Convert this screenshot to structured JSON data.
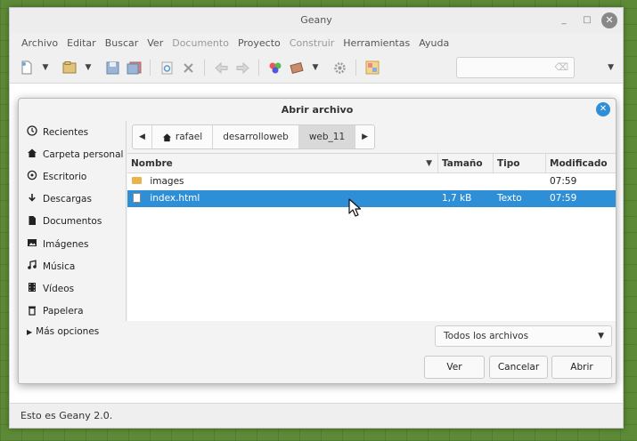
{
  "window": {
    "title": "Geany",
    "controls": {
      "minimize": "_",
      "maximize": "□",
      "close": "✕"
    }
  },
  "menubar": [
    {
      "label": "Archivo",
      "disabled": false
    },
    {
      "label": "Editar",
      "disabled": false
    },
    {
      "label": "Buscar",
      "disabled": false
    },
    {
      "label": "Ver",
      "disabled": false
    },
    {
      "label": "Documento",
      "disabled": true
    },
    {
      "label": "Proyecto",
      "disabled": false
    },
    {
      "label": "Construir",
      "disabled": true
    },
    {
      "label": "Herramientas",
      "disabled": false
    },
    {
      "label": "Ayuda",
      "disabled": false
    }
  ],
  "toolbar": {
    "icons": [
      "new-file-icon",
      "open-file-icon",
      "save-icon",
      "save-all-icon",
      "reload-icon",
      "close-file-icon",
      "back-icon",
      "forward-icon",
      "color-chooser-icon",
      "compile-icon",
      "build-icon",
      "preferences-icon",
      "jump-to-line-icon"
    ]
  },
  "statusbar": {
    "text": "Esto es Geany 2.0."
  },
  "dialog": {
    "title": "Abrir archivo",
    "places": [
      {
        "label": "Recientes",
        "icon": "clock-icon"
      },
      {
        "label": "Carpeta personal",
        "icon": "home-icon"
      },
      {
        "label": "Escritorio",
        "icon": "desktop-icon"
      },
      {
        "label": "Descargas",
        "icon": "download-icon"
      },
      {
        "label": "Documentos",
        "icon": "document-icon"
      },
      {
        "label": "Imágenes",
        "icon": "image-icon"
      },
      {
        "label": "Música",
        "icon": "music-icon"
      },
      {
        "label": "Vídeos",
        "icon": "video-icon"
      },
      {
        "label": "Papelera",
        "icon": "trash-icon"
      }
    ],
    "more_options": "Más opciones",
    "path": [
      "rafael",
      "desarrolloweb",
      "web_11"
    ],
    "columns": {
      "name": "Nombre",
      "size": "Tamaño",
      "type": "Tipo",
      "modified": "Modificado"
    },
    "files": [
      {
        "name": "images",
        "kind": "folder",
        "size": "",
        "type": "",
        "modified": "07:59",
        "selected": false
      },
      {
        "name": "index.html",
        "kind": "file",
        "size": "1,7 kB",
        "type": "Texto",
        "modified": "07:59",
        "selected": true
      }
    ],
    "filter": "Todos los archivos",
    "buttons": {
      "view": "Ver",
      "cancel": "Cancelar",
      "open": "Abrir"
    }
  },
  "colors": {
    "accent": "#2e8fd6",
    "folder": "#e9b44c"
  }
}
